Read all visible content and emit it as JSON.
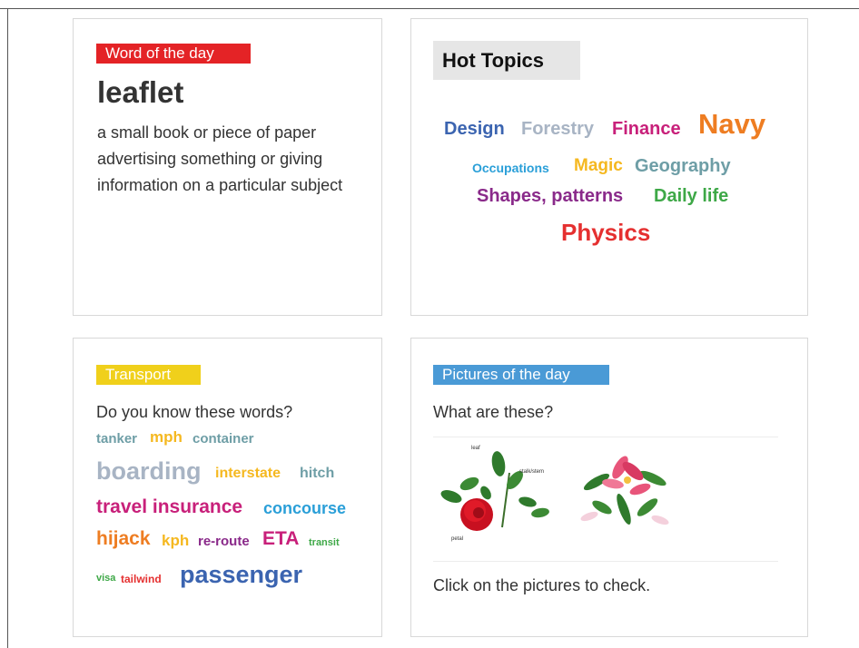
{
  "word_of_day": {
    "label": "Word of the day",
    "word": "leaflet",
    "definition": "a small book or piece of paper advertising something or giving information on a particular subject"
  },
  "hot_topics": {
    "title": "Hot Topics",
    "topics": [
      {
        "text": "Design",
        "color": "#3b64b0"
      },
      {
        "text": "Forestry",
        "color": "#a8b4c4"
      },
      {
        "text": "Finance",
        "color": "#c8207a"
      },
      {
        "text": "Navy",
        "color": "#ee7d22"
      },
      {
        "text": "Occupations",
        "color": "#2a9fd8"
      },
      {
        "text": "Magic",
        "color": "#f5b820"
      },
      {
        "text": "Geography",
        "color": "#6e9ea6"
      },
      {
        "text": "Shapes, patterns",
        "color": "#8a2a8a"
      },
      {
        "text": "Daily life",
        "color": "#3ea847"
      },
      {
        "text": "Physics",
        "color": "#e53030"
      }
    ]
  },
  "transport": {
    "label": "Transport",
    "question": "Do you know these words?",
    "words": [
      {
        "text": "tanker",
        "color": "#6e9ea6"
      },
      {
        "text": "mph",
        "color": "#f5b820"
      },
      {
        "text": "container",
        "color": "#6e9ea6"
      },
      {
        "text": "boarding",
        "color": "#a8b4c4"
      },
      {
        "text": "interstate",
        "color": "#f5b820"
      },
      {
        "text": "hitch",
        "color": "#6e9ea6"
      },
      {
        "text": "travel insurance",
        "color": "#c8207a"
      },
      {
        "text": "concourse",
        "color": "#2a9fd8"
      },
      {
        "text": "hijack",
        "color": "#ee7d22"
      },
      {
        "text": "kph",
        "color": "#f5b820"
      },
      {
        "text": "re-route",
        "color": "#8a2a8a"
      },
      {
        "text": "ETA",
        "color": "#c8207a"
      },
      {
        "text": "transit",
        "color": "#3ea847"
      },
      {
        "text": "visa",
        "color": "#3ea847"
      },
      {
        "text": "tailwind",
        "color": "#e53030"
      },
      {
        "text": "passenger",
        "color": "#3b64b0"
      }
    ]
  },
  "pictures": {
    "label": "Pictures of the day",
    "question": "What are these?",
    "footer": "Click on the pictures to check.",
    "rose_labels": {
      "leaf": "leaf",
      "stalk": "stalk/stem",
      "petal": "petal"
    }
  }
}
